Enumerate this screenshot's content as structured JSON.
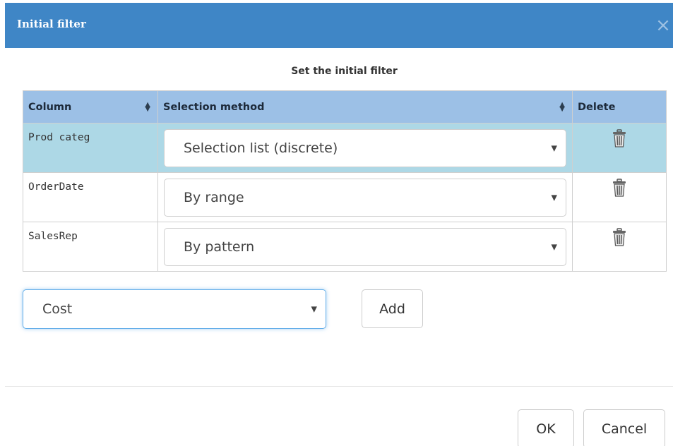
{
  "dialog": {
    "title": "Initial filter",
    "close_glyph": "×",
    "subtitle": "Set the initial filter"
  },
  "table": {
    "headers": {
      "column": "Column",
      "method": "Selection method",
      "delete": "Delete"
    },
    "sort_icon": "sort-up-down-icon",
    "rows": [
      {
        "column": "Prod categ",
        "method": "Selection list (discrete)",
        "selected": true
      },
      {
        "column": "OrderDate",
        "method": "By range",
        "selected": false
      },
      {
        "column": "SalesRep",
        "method": "By pattern",
        "selected": false
      }
    ],
    "delete_icon": "trash-icon"
  },
  "add_row": {
    "selected_value": "Cost",
    "add_label": "Add"
  },
  "footer": {
    "ok_label": "OK",
    "cancel_label": "Cancel"
  },
  "colors": {
    "titlebar": "#3f86c6",
    "header_bg": "#9cc0e6",
    "selected_row": "#add8e6",
    "focus_border": "#66afe9"
  }
}
